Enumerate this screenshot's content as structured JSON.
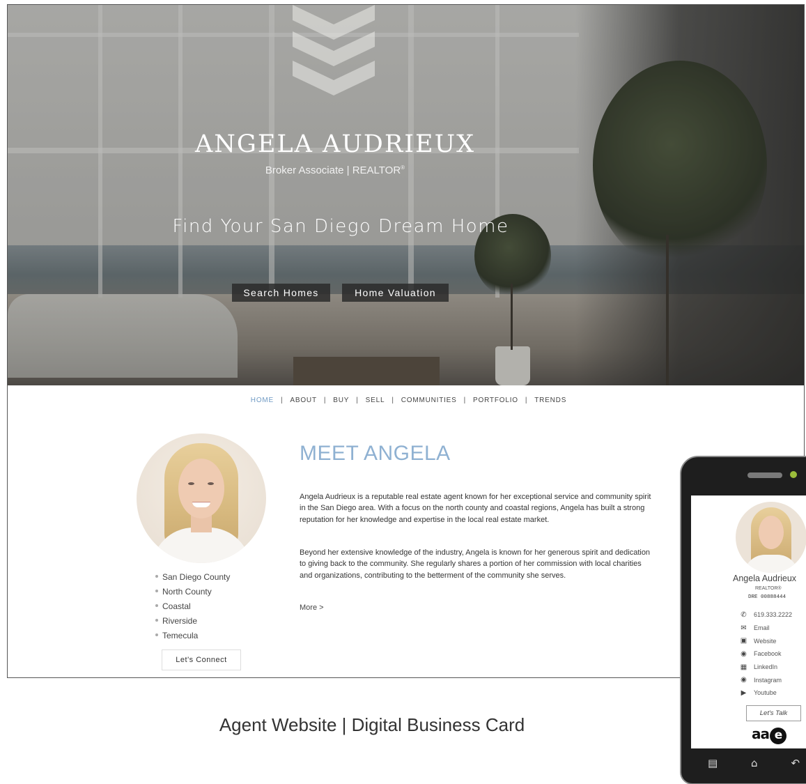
{
  "hero": {
    "name": "ANGELA AUDRIEUX",
    "subtitle": "Broker Associate | REALTOR",
    "subtitle_mark": "®",
    "tagline": "Find Your San Diego Dream Home",
    "search_button": "Search Homes",
    "valuation_button": "Home Valuation"
  },
  "nav": {
    "items": [
      {
        "label": "HOME",
        "active": true
      },
      {
        "label": "ABOUT"
      },
      {
        "label": "BUY"
      },
      {
        "label": "SELL"
      },
      {
        "label": "COMMUNITIES"
      },
      {
        "label": "PORTFOLIO"
      },
      {
        "label": "TRENDS"
      }
    ],
    "separator": "|"
  },
  "about": {
    "areas": [
      "San Diego County",
      "North County",
      "Coastal",
      "Riverside",
      "Temecula"
    ],
    "connect_button": "Let's Connect",
    "title": "MEET ANGELA",
    "paragraph1": "Angela Audrieux is a reputable real estate agent known for her exceptional service and community spirit in the San Diego area. With a focus on the north county and coastal regions, Angela has built a strong reputation for her knowledge and expertise in the local real estate market.",
    "paragraph2": "Beyond her extensive knowledge of the industry, Angela is known for her generous spirit and dedication to giving back to the community. She regularly shares a portion of her commission with local charities and organizations, contributing to the betterment of the community she serves.",
    "more_link": "More >"
  },
  "caption": "Agent Website | Digital Business Card",
  "card": {
    "name": "Angela Audrieux",
    "title": "REALTOR®",
    "dre": "DRE 00888444",
    "links": [
      {
        "icon": "phone-icon",
        "label": "619.333.2222"
      },
      {
        "icon": "email-icon",
        "label": "Email"
      },
      {
        "icon": "website-icon",
        "label": "Website"
      },
      {
        "icon": "facebook-icon",
        "label": "Facebook"
      },
      {
        "icon": "linkedin-icon",
        "label": "LinkedIn"
      },
      {
        "icon": "instagram-icon",
        "label": "Instagram"
      },
      {
        "icon": "youtube-icon",
        "label": "Youtube"
      }
    ],
    "talk_button": "Let's Talk",
    "logo_text": "aa",
    "logo_mark": "e"
  },
  "colors": {
    "accent": "#8fb1d2",
    "nav_active": "#6f9ac4",
    "button_dark": "#2b2b2b",
    "phone_body": "#1e1e1e"
  }
}
